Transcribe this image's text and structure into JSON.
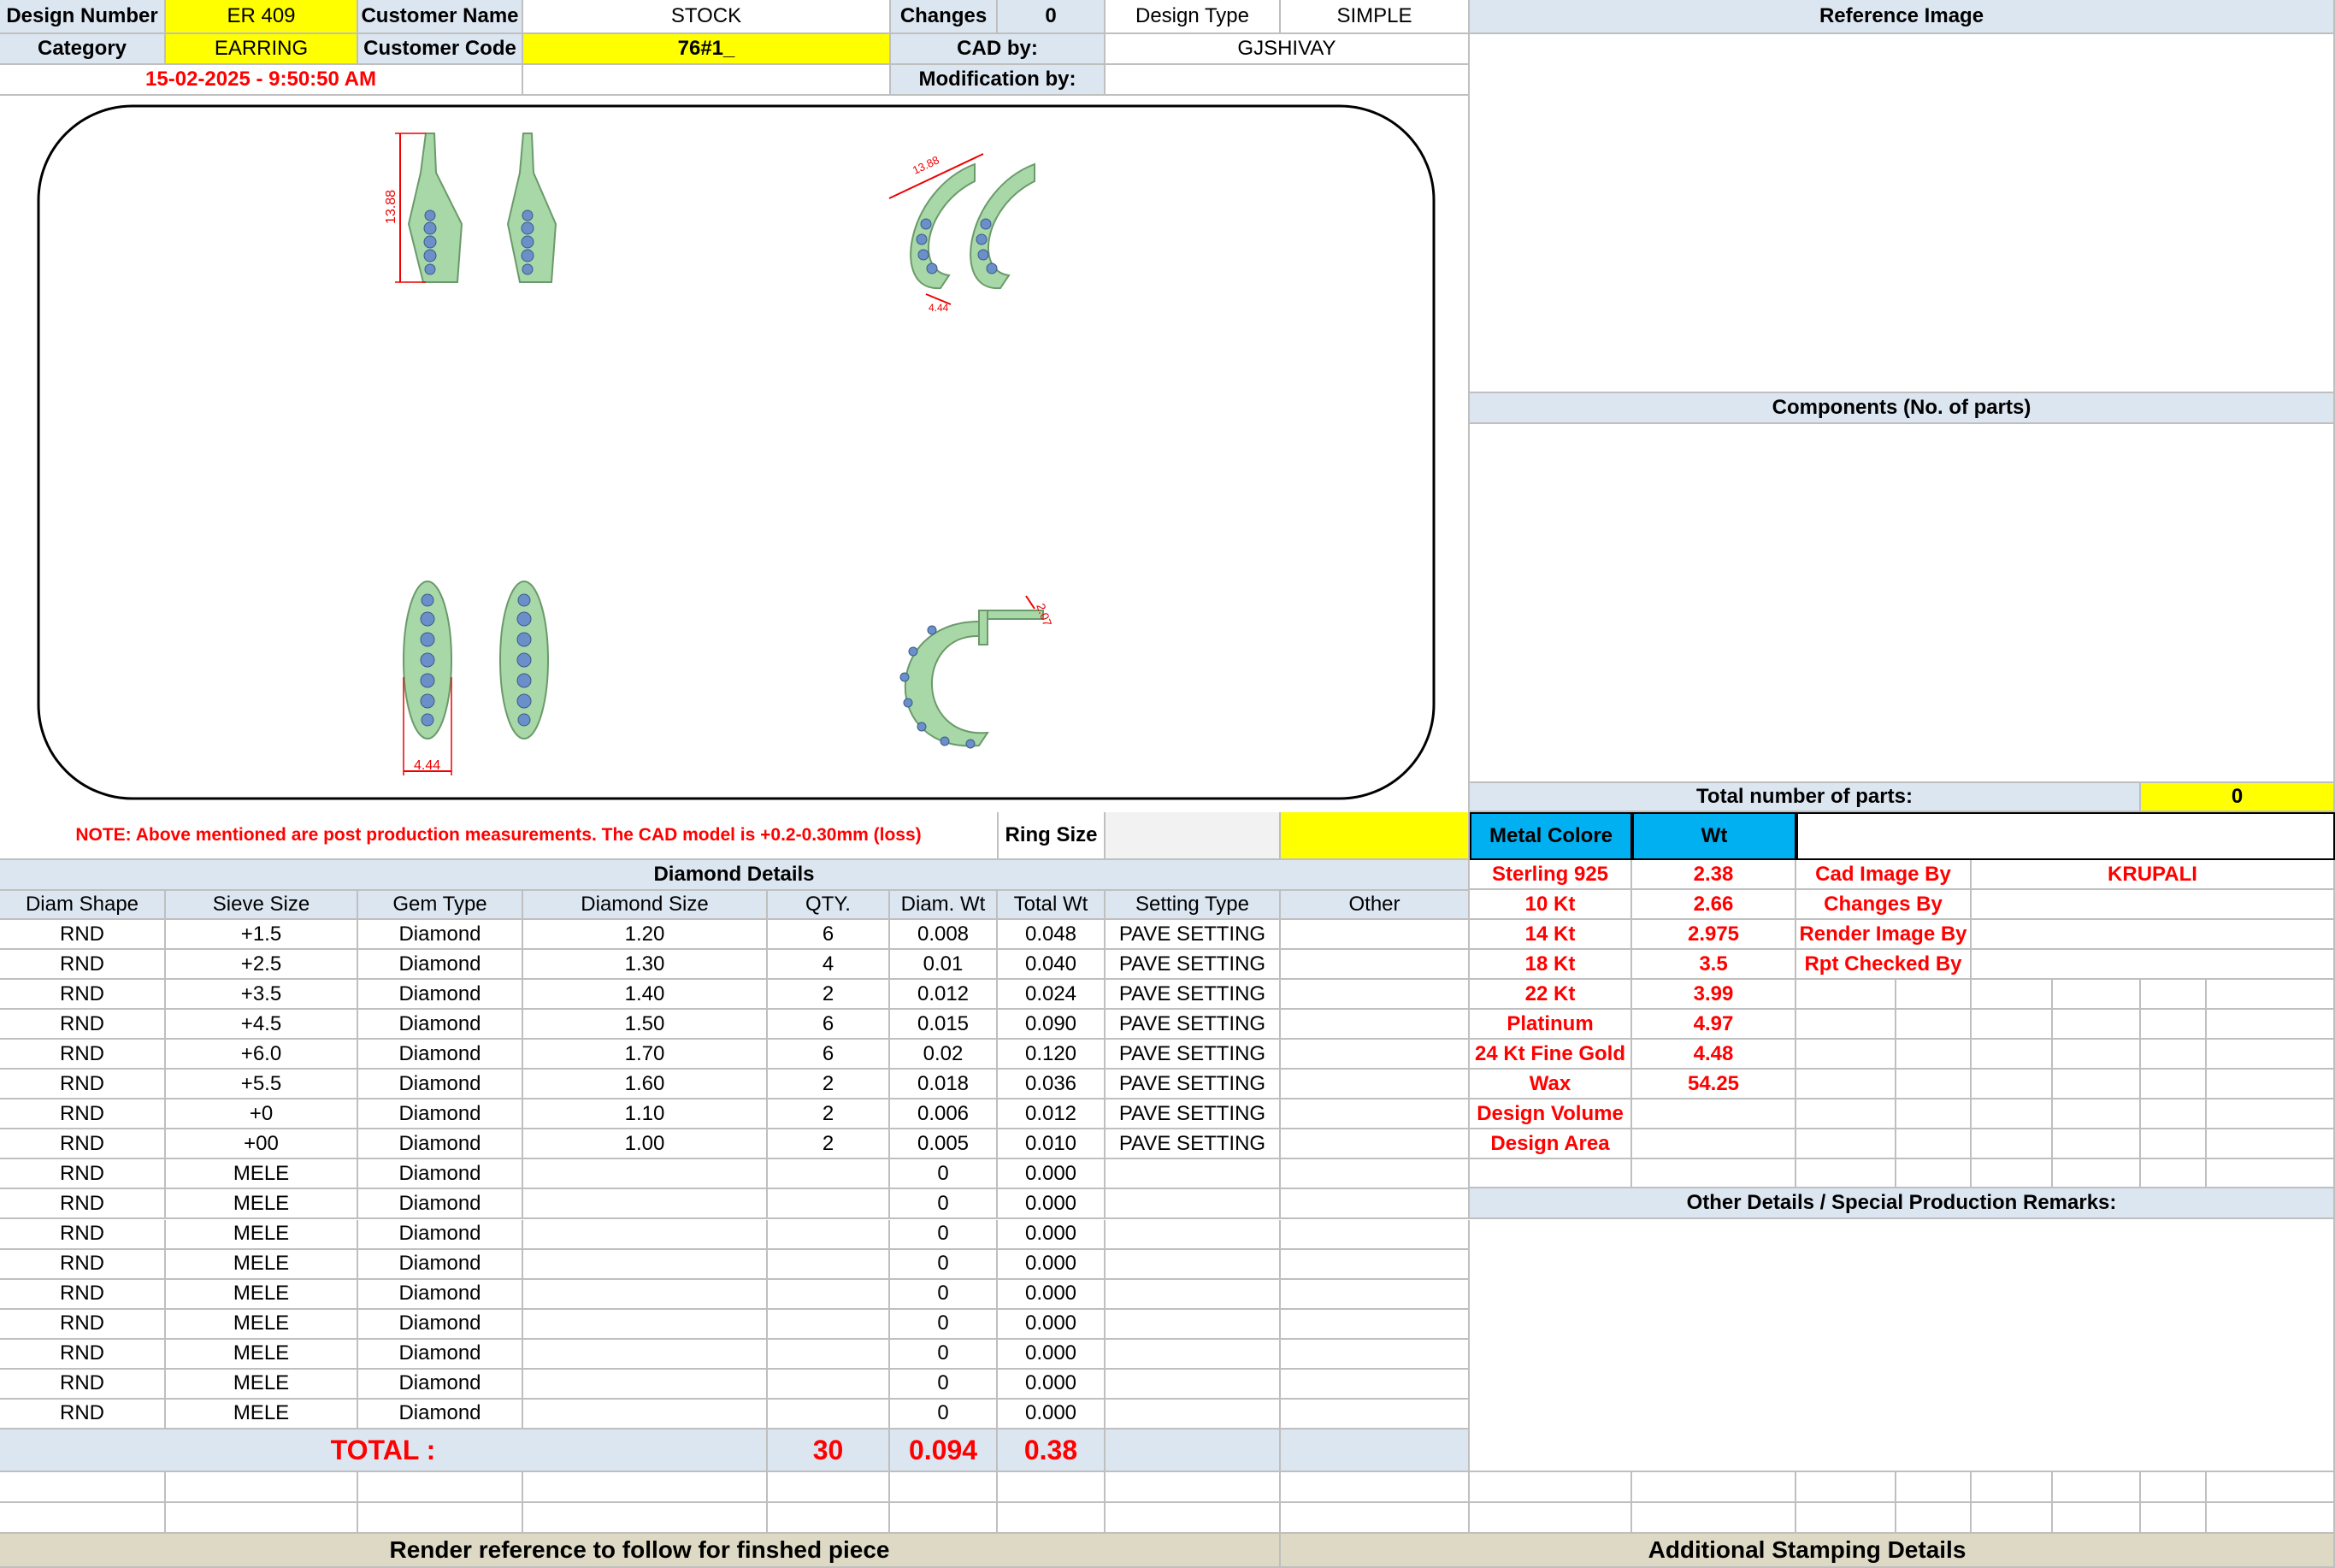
{
  "header": {
    "design_number_label": "Design Number",
    "design_number": "ER 409",
    "customer_name_label": "Customer Name",
    "customer_name": "STOCK",
    "changes_label": "Changes",
    "changes": "0",
    "design_type_label": "Design Type",
    "design_type": "SIMPLE",
    "category_label": "Category",
    "category": "EARRING",
    "customer_code_label": "Customer Code",
    "customer_code": "76#1_",
    "cad_by_label": "CAD by:",
    "cad_by": "GJSHIVAY",
    "datetime": "15-02-2025 - 9:50:50 AM",
    "modification_label": "Modification by:",
    "modification": ""
  },
  "right": {
    "reference_image": "Reference Image",
    "components": "Components (No. of parts)",
    "total_parts_label": "Total number of parts:",
    "total_parts": "0",
    "other_details": "Other Details / Special Production Remarks:"
  },
  "cad": {
    "dim_height": "13.88",
    "dim_width": "4.44",
    "dim_side_a": "13.88",
    "dim_side_b": "4.44",
    "dim_c": "2.07"
  },
  "note": "NOTE: Above mentioned are post production measurements. The CAD model is +0.2-0.30mm (loss)",
  "ring_size_label": "Ring Size",
  "metal": {
    "col_label": "Metal Colore",
    "wt_label": "Wt",
    "rows": [
      {
        "name": "Sterling 925",
        "wt": "2.38"
      },
      {
        "name": "10 Kt",
        "wt": "2.66"
      },
      {
        "name": "14 Kt",
        "wt": "2.975"
      },
      {
        "name": "18 Kt",
        "wt": "3.5"
      },
      {
        "name": "22 Kt",
        "wt": "3.99"
      },
      {
        "name": "Platinum",
        "wt": "4.97"
      },
      {
        "name": "24 Kt Fine Gold",
        "wt": "4.48"
      },
      {
        "name": "Wax",
        "wt": "54.25"
      },
      {
        "name": "Design Volume",
        "wt": ""
      },
      {
        "name": "Design Area",
        "wt": ""
      }
    ]
  },
  "credits": [
    {
      "label": "Cad Image By",
      "value": "KRUPALI"
    },
    {
      "label": "Changes By",
      "value": ""
    },
    {
      "label": "Render Image By",
      "value": ""
    },
    {
      "label": "Rpt Checked By",
      "value": ""
    }
  ],
  "diamond": {
    "title": "Diamond Details",
    "columns": [
      "Diam Shape",
      "Sieve Size",
      "Gem Type",
      "Diamond Size",
      "QTY.",
      "Diam. Wt",
      "Total Wt",
      "Setting Type",
      "Other"
    ],
    "rows": [
      [
        "RND",
        "+1.5",
        "Diamond",
        "1.20",
        "6",
        "0.008",
        "0.048",
        "PAVE SETTING",
        ""
      ],
      [
        "RND",
        "+2.5",
        "Diamond",
        "1.30",
        "4",
        "0.01",
        "0.040",
        "PAVE SETTING",
        ""
      ],
      [
        "RND",
        "+3.5",
        "Diamond",
        "1.40",
        "2",
        "0.012",
        "0.024",
        "PAVE SETTING",
        ""
      ],
      [
        "RND",
        "+4.5",
        "Diamond",
        "1.50",
        "6",
        "0.015",
        "0.090",
        "PAVE SETTING",
        ""
      ],
      [
        "RND",
        "+6.0",
        "Diamond",
        "1.70",
        "6",
        "0.02",
        "0.120",
        "PAVE SETTING",
        ""
      ],
      [
        "RND",
        "+5.5",
        "Diamond",
        "1.60",
        "2",
        "0.018",
        "0.036",
        "PAVE SETTING",
        ""
      ],
      [
        "RND",
        "+0",
        "Diamond",
        "1.10",
        "2",
        "0.006",
        "0.012",
        "PAVE SETTING",
        ""
      ],
      [
        "RND",
        "+00",
        "Diamond",
        "1.00",
        "2",
        "0.005",
        "0.010",
        "PAVE SETTING",
        ""
      ],
      [
        "RND",
        "MELE",
        "Diamond",
        "",
        "",
        "0",
        "0.000",
        "",
        ""
      ],
      [
        "RND",
        "MELE",
        "Diamond",
        "",
        "",
        "0",
        "0.000",
        "",
        ""
      ],
      [
        "RND",
        "MELE",
        "Diamond",
        "",
        "",
        "0",
        "0.000",
        "",
        ""
      ],
      [
        "RND",
        "MELE",
        "Diamond",
        "",
        "",
        "0",
        "0.000",
        "",
        ""
      ],
      [
        "RND",
        "MELE",
        "Diamond",
        "",
        "",
        "0",
        "0.000",
        "",
        ""
      ],
      [
        "RND",
        "MELE",
        "Diamond",
        "",
        "",
        "0",
        "0.000",
        "",
        ""
      ],
      [
        "RND",
        "MELE",
        "Diamond",
        "",
        "",
        "0",
        "0.000",
        "",
        ""
      ],
      [
        "RND",
        "MELE",
        "Diamond",
        "",
        "",
        "0",
        "0.000",
        "",
        ""
      ],
      [
        "RND",
        "MELE",
        "Diamond",
        "",
        "",
        "0",
        "0.000",
        "",
        ""
      ]
    ],
    "total_label": "TOTAL :",
    "total_qty": "30",
    "total_diam_wt": "0.094",
    "total_wt": "0.38"
  },
  "footer": {
    "render_ref": "Render reference to follow for finshed piece",
    "stamping": "Additional Stamping Details"
  },
  "colors": {
    "header_blue": "#dce6f1",
    "highlight_yellow": "#ffff00",
    "metal_blue": "#00b0f0",
    "red_text": "#ff0000",
    "footer_tan": "#ddd9c4",
    "metal_green": "#a8d8a8",
    "stone_blue": "#6b8fc8"
  }
}
